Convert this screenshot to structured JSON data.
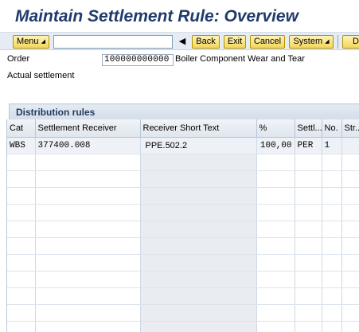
{
  "title": "Maintain Settlement Rule: Overview",
  "toolbar": {
    "menu_label": "Menu",
    "command_value": "",
    "back_label": "Back",
    "exit_label": "Exit",
    "cancel_label": "Cancel",
    "system_label": "System",
    "extra_label": "D"
  },
  "header": {
    "order_label": "Order",
    "order_value": "100000000000",
    "order_description": "Boiler Component Wear and Tear",
    "actual_settlement_label": "Actual settlement"
  },
  "distribution": {
    "title": "Distribution rules",
    "columns": [
      "Cat",
      "Settlement Receiver",
      "Receiver Short Text",
      "%",
      "Settl...",
      "No.",
      "Str..."
    ],
    "rows": [
      {
        "cat": "WBS",
        "receiver": "377400.008",
        "short_text": "PPE.502.2",
        "percent": "100,00",
        "settl": "PER",
        "no": "1",
        "str": ""
      }
    ]
  }
}
